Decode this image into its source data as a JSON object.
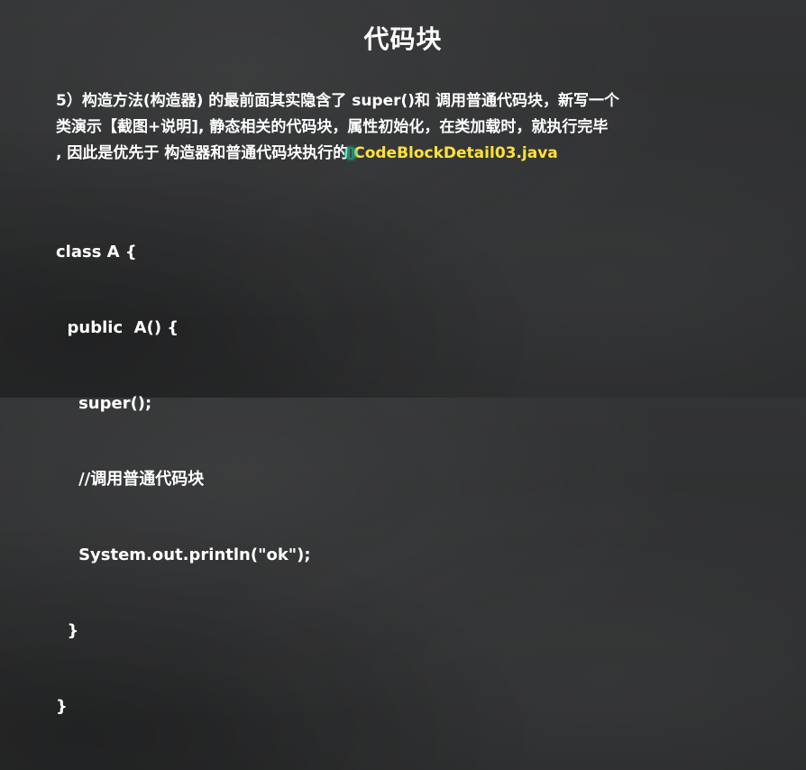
{
  "slide": {
    "title": "代码块",
    "description": {
      "line1": "5）构造方法(构造器) 的最前面其实隐含了 super()和 调用普通代码块，新写一个",
      "line2": "类演示【截图+说明], 静态相关的代码块，属性初始化，在类加载时，就执行完毕",
      "line3_prefix": ", 因此是优先于 构造器和普通代码块执行的",
      "file_name": "CodeBlockDetail03.java"
    },
    "code_lines": [
      "class A {",
      "  public  A() {",
      "    super();",
      "    //调用普通代码块",
      "    System.out.println(\"ok\");",
      "  }",
      "}"
    ]
  },
  "colors": {
    "background": "#2e2f30",
    "text": "#ffffff",
    "highlight": "#ffe23a"
  },
  "icons": {
    "cursor": "text-cursor-icon"
  }
}
